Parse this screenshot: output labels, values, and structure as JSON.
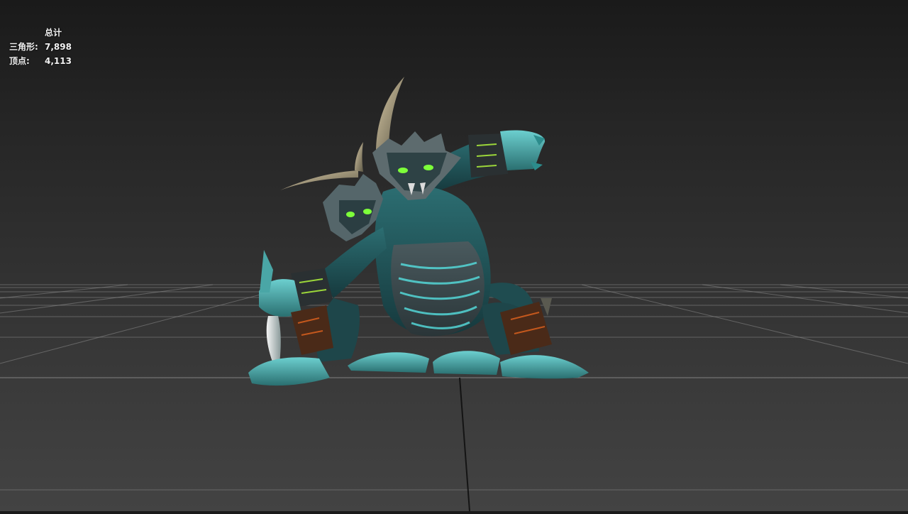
{
  "viewport": {
    "stats": {
      "title": "总计",
      "triangles_label": "三角形:",
      "triangles_value": "7,898",
      "vertices_label": "顶点:",
      "vertices_value": "4,113"
    },
    "model": {
      "name": "creature-model-icon"
    },
    "colors": {
      "bg_top": "#1a1a1a",
      "bg_bottom": "#434343",
      "grid": "#8a8a8a",
      "accent_glow": "#55e0e0",
      "eye_green": "#7dff3a"
    }
  }
}
